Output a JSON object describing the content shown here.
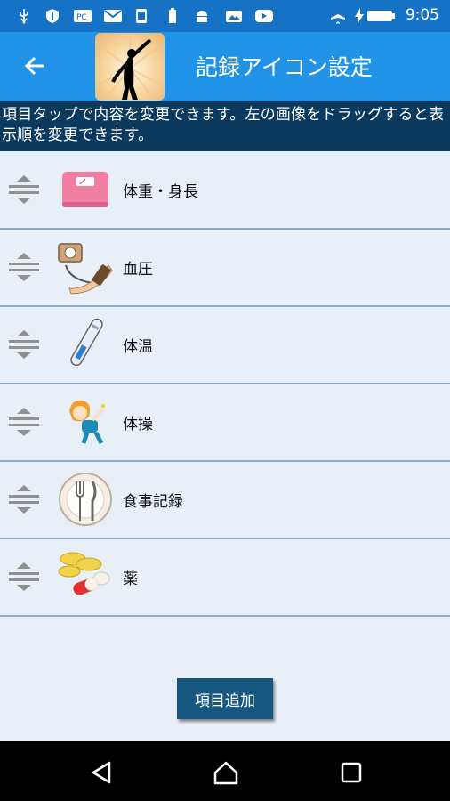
{
  "status": {
    "time": "9:05"
  },
  "appbar": {
    "title": "記録アイコン設定"
  },
  "info": {
    "text": "項目タップで内容を変更できます。左の画像をドラッグすると表示順を変更できます。"
  },
  "items": [
    {
      "label": "体重・身長",
      "icon": "scale-icon"
    },
    {
      "label": "血圧",
      "icon": "blood-pressure-icon"
    },
    {
      "label": "体温",
      "icon": "thermometer-icon"
    },
    {
      "label": "体操",
      "icon": "exercise-icon"
    },
    {
      "label": "食事記録",
      "icon": "meal-icon"
    },
    {
      "label": "薬",
      "icon": "medicine-icon"
    }
  ],
  "add_button": "項目追加",
  "colors": {
    "statusbar": "#1672c4",
    "appbar": "#2193e6",
    "infobar": "#0b3a5e",
    "button": "#16577f",
    "background": "#e9eff6"
  }
}
